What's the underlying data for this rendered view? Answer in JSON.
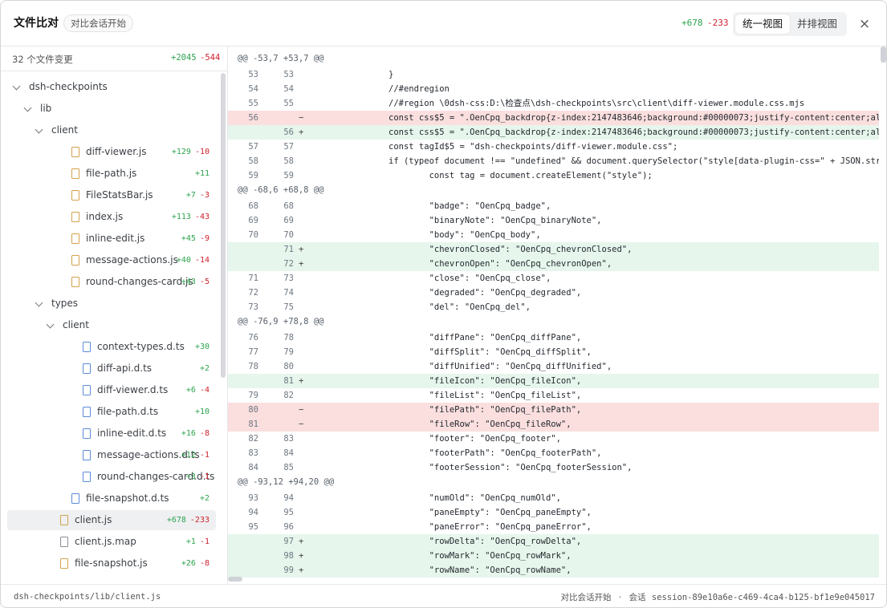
{
  "header": {
    "title": "文件比对",
    "subtitle": "对比会话开始",
    "additions": "+678",
    "deletions": "-233",
    "view_unified": "统一视图",
    "view_split": "并排视图",
    "close_glyph": "×"
  },
  "sidebar": {
    "count_label": "32 个文件变更",
    "additions": "+2045",
    "deletions": "-544",
    "tree": [
      {
        "type": "dir",
        "depth": 0,
        "label": "dsh-checkpoints"
      },
      {
        "type": "dir",
        "depth": 1,
        "label": "lib"
      },
      {
        "type": "dir",
        "depth": 2,
        "label": "client"
      },
      {
        "type": "file",
        "icon": "js-file-icon",
        "depth": 3,
        "label": "diff-viewer.js",
        "add": "+129",
        "del": "-10"
      },
      {
        "type": "file",
        "icon": "js-file-icon",
        "depth": 3,
        "label": "file-path.js",
        "add": "+11",
        "del": ""
      },
      {
        "type": "file",
        "icon": "js-file-icon",
        "depth": 3,
        "label": "FileStatsBar.js",
        "add": "+7",
        "del": "-3"
      },
      {
        "type": "file",
        "icon": "js-file-icon",
        "depth": 3,
        "label": "index.js",
        "add": "+113",
        "del": "-43"
      },
      {
        "type": "file",
        "icon": "js-file-icon",
        "depth": 3,
        "label": "inline-edit.js",
        "add": "+45",
        "del": "-9"
      },
      {
        "type": "file",
        "icon": "js-file-icon",
        "depth": 3,
        "label": "message-actions.js",
        "add": "+40",
        "del": "-14"
      },
      {
        "type": "file",
        "icon": "js-file-icon",
        "depth": 3,
        "label": "round-changes-card.js",
        "add": "+43",
        "del": "-5"
      },
      {
        "type": "dir",
        "depth": 2,
        "label": "types"
      },
      {
        "type": "dir",
        "depth": 3,
        "label": "client"
      },
      {
        "type": "file",
        "icon": "ts-file-icon",
        "depth": 4,
        "label": "context-types.d.ts",
        "add": "+30",
        "del": ""
      },
      {
        "type": "file",
        "icon": "ts-file-icon",
        "depth": 4,
        "label": "diff-api.d.ts",
        "add": "+2",
        "del": ""
      },
      {
        "type": "file",
        "icon": "ts-file-icon",
        "depth": 4,
        "label": "diff-viewer.d.ts",
        "add": "+6",
        "del": "-4"
      },
      {
        "type": "file",
        "icon": "ts-file-icon",
        "depth": 4,
        "label": "file-path.d.ts",
        "add": "+10",
        "del": ""
      },
      {
        "type": "file",
        "icon": "ts-file-icon",
        "depth": 4,
        "label": "inline-edit.d.ts",
        "add": "+16",
        "del": "-8"
      },
      {
        "type": "file",
        "icon": "ts-file-icon",
        "depth": 4,
        "label": "message-actions.d.ts",
        "add": "+12",
        "del": "-1"
      },
      {
        "type": "file",
        "icon": "ts-file-icon",
        "depth": 4,
        "label": "round-changes-card.d.ts",
        "add": "+3",
        "del": "-1"
      },
      {
        "type": "file",
        "icon": "ts-file-icon",
        "depth": 3,
        "label": "file-snapshot.d.ts",
        "add": "+2",
        "del": ""
      },
      {
        "type": "file",
        "icon": "js-file-icon",
        "depth": 2,
        "label": "client.js",
        "add": "+678",
        "del": "-233",
        "selected": true
      },
      {
        "type": "file",
        "icon": "map-file-icon",
        "depth": 2,
        "label": "client.js.map",
        "add": "+1",
        "del": "-1"
      },
      {
        "type": "file",
        "icon": "js-file-icon",
        "depth": 2,
        "label": "file-snapshot.js",
        "add": "+26",
        "del": "-8"
      }
    ]
  },
  "diff": {
    "rows": [
      {
        "kind": "hunk",
        "text": "@@ -53,7 +53,7 @@"
      },
      {
        "kind": "ctx",
        "old": "53",
        "new": "53",
        "code": "}"
      },
      {
        "kind": "ctx",
        "old": "54",
        "new": "54",
        "code": "//#endregion"
      },
      {
        "kind": "ctx",
        "old": "55",
        "new": "55",
        "code": "//#region \\0dsh-css:D:\\检查点\\dsh-checkpoints\\src\\client\\diff-viewer.module.css.mjs"
      },
      {
        "kind": "del",
        "old": "56",
        "new": "",
        "code": "const css$5 = \".OenCpq_backdrop{z-index:2147483646;background:#00000073;justify-content:center;align-i"
      },
      {
        "kind": "add",
        "old": "",
        "new": "56",
        "code": "const css$5 = \".OenCpq_backdrop{z-index:2147483646;background:#00000073;justify-content:center;align-i"
      },
      {
        "kind": "ctx",
        "old": "57",
        "new": "57",
        "code": "const tagId$5 = \"dsh-checkpoints/diff-viewer.module.css\";"
      },
      {
        "kind": "ctx",
        "old": "58",
        "new": "58",
        "code": "if (typeof document !== \"undefined\" && document.querySelector(\"style[data-plugin-css=\" + JSON.stringif"
      },
      {
        "kind": "ctx",
        "old": "59",
        "new": "59",
        "code": "        const tag = document.createElement(\"style\");"
      },
      {
        "kind": "hunk",
        "text": "@@ -68,6 +68,8 @@"
      },
      {
        "kind": "ctx",
        "old": "68",
        "new": "68",
        "code": "        \"badge\": \"OenCpq_badge\","
      },
      {
        "kind": "ctx",
        "old": "69",
        "new": "69",
        "code": "        \"binaryNote\": \"OenCpq_binaryNote\","
      },
      {
        "kind": "ctx",
        "old": "70",
        "new": "70",
        "code": "        \"body\": \"OenCpq_body\","
      },
      {
        "kind": "add",
        "old": "",
        "new": "71",
        "code": "        \"chevronClosed\": \"OenCpq_chevronClosed\","
      },
      {
        "kind": "add",
        "old": "",
        "new": "72",
        "code": "        \"chevronOpen\": \"OenCpq_chevronOpen\","
      },
      {
        "kind": "ctx",
        "old": "71",
        "new": "73",
        "code": "        \"close\": \"OenCpq_close\","
      },
      {
        "kind": "ctx",
        "old": "72",
        "new": "74",
        "code": "        \"degraded\": \"OenCpq_degraded\","
      },
      {
        "kind": "ctx",
        "old": "73",
        "new": "75",
        "code": "        \"del\": \"OenCpq_del\","
      },
      {
        "kind": "hunk",
        "text": "@@ -76,9 +78,8 @@"
      },
      {
        "kind": "ctx",
        "old": "76",
        "new": "78",
        "code": "        \"diffPane\": \"OenCpq_diffPane\","
      },
      {
        "kind": "ctx",
        "old": "77",
        "new": "79",
        "code": "        \"diffSplit\": \"OenCpq_diffSplit\","
      },
      {
        "kind": "ctx",
        "old": "78",
        "new": "80",
        "code": "        \"diffUnified\": \"OenCpq_diffUnified\","
      },
      {
        "kind": "add",
        "old": "",
        "new": "81",
        "code": "        \"fileIcon\": \"OenCpq_fileIcon\","
      },
      {
        "kind": "ctx",
        "old": "79",
        "new": "82",
        "code": "        \"fileList\": \"OenCpq_fileList\","
      },
      {
        "kind": "del",
        "old": "80",
        "new": "",
        "code": "        \"filePath\": \"OenCpq_filePath\","
      },
      {
        "kind": "del",
        "old": "81",
        "new": "",
        "code": "        \"fileRow\": \"OenCpq_fileRow\","
      },
      {
        "kind": "ctx",
        "old": "82",
        "new": "83",
        "code": "        \"footer\": \"OenCpq_footer\","
      },
      {
        "kind": "ctx",
        "old": "83",
        "new": "84",
        "code": "        \"footerPath\": \"OenCpq_footerPath\","
      },
      {
        "kind": "ctx",
        "old": "84",
        "new": "85",
        "code": "        \"footerSession\": \"OenCpq_footerSession\","
      },
      {
        "kind": "hunk",
        "text": "@@ -93,12 +94,20 @@"
      },
      {
        "kind": "ctx",
        "old": "93",
        "new": "94",
        "code": "        \"numOld\": \"OenCpq_numOld\","
      },
      {
        "kind": "ctx",
        "old": "94",
        "new": "95",
        "code": "        \"paneEmpty\": \"OenCpq_paneEmpty\","
      },
      {
        "kind": "ctx",
        "old": "95",
        "new": "96",
        "code": "        \"paneError\": \"OenCpq_paneError\","
      },
      {
        "kind": "add",
        "old": "",
        "new": "97",
        "code": "        \"rowDelta\": \"OenCpq_rowDelta\","
      },
      {
        "kind": "add",
        "old": "",
        "new": "98",
        "code": "        \"rowMark\": \"OenCpq_rowMark\","
      },
      {
        "kind": "add",
        "old": "",
        "new": "99",
        "code": "        \"rowName\": \"OenCpq_rowName\","
      }
    ]
  },
  "footer": {
    "path": "dsh-checkpoints/lib/client.js",
    "session_start": "对比会话开始",
    "separator": "·",
    "session_label": "会话",
    "session_id": "session-89e10a6e-c469-4ca4-b125-bf1e9e045017"
  }
}
